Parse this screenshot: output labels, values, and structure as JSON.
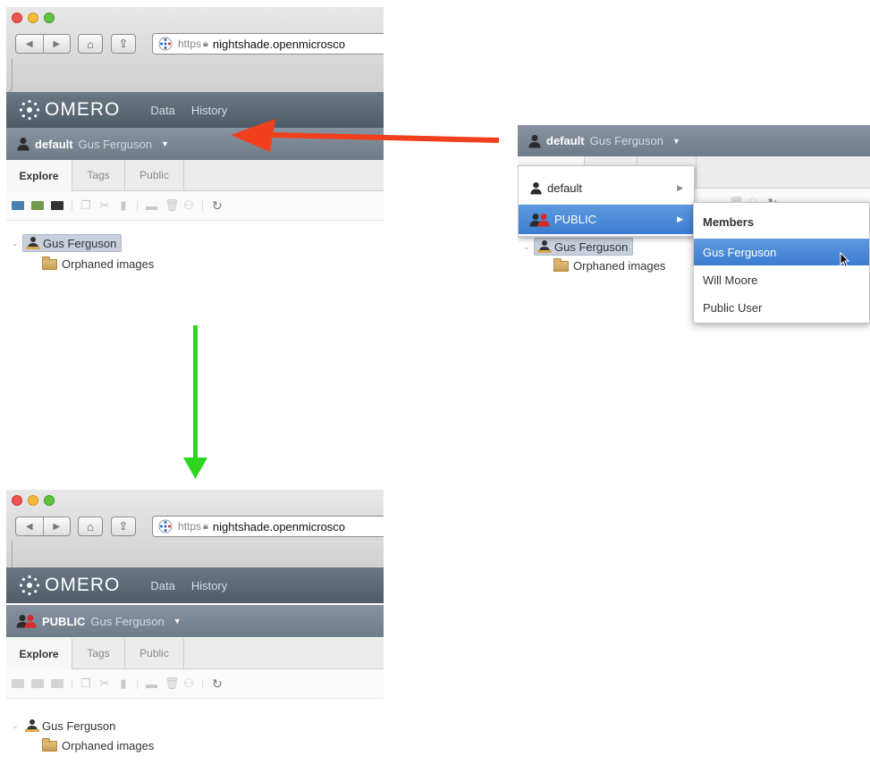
{
  "browser": {
    "protocol": "https",
    "host": "nightshade.openmicrosco"
  },
  "omero": {
    "logo_text": "OMERO",
    "nav": [
      "Data",
      "History"
    ]
  },
  "before": {
    "group_name": "default",
    "user_name": "Gus Ferguson",
    "tabs": [
      "Explore",
      "Tags",
      "Public"
    ],
    "tree": {
      "user": "Gus Ferguson",
      "folder": "Orphaned images"
    }
  },
  "menu_view": {
    "group_name": "default",
    "user_name": "Gus Ferguson",
    "groups": [
      "default",
      "PUBLIC"
    ],
    "submenu_title": "Members",
    "members": [
      "Gus Ferguson",
      "Will Moore",
      "Public User"
    ],
    "tree": {
      "user": "Gus Ferguson",
      "folder": "Orphaned images"
    }
  },
  "after": {
    "group_name": "PUBLIC",
    "user_name": "Gus Ferguson",
    "tabs": [
      "Explore",
      "Tags",
      "Public"
    ],
    "tree": {
      "user": "Gus Ferguson",
      "folder": "Orphaned images"
    }
  },
  "colors": {
    "arrow_red": "#f0401e",
    "arrow_green": "#2fd61e",
    "header_bg": "#5d6a76",
    "groupbar_bg": "#7b8793",
    "selection_blue": "#4a8ad8"
  },
  "icons": [
    "back-icon",
    "forward-icon",
    "home-icon",
    "share-icon",
    "site-icon",
    "lock-icon",
    "omero-logo-icon",
    "user-icon",
    "group-icon",
    "caret-down-icon",
    "folder-icon",
    "refresh-icon",
    "mouse-cursor-icon"
  ]
}
